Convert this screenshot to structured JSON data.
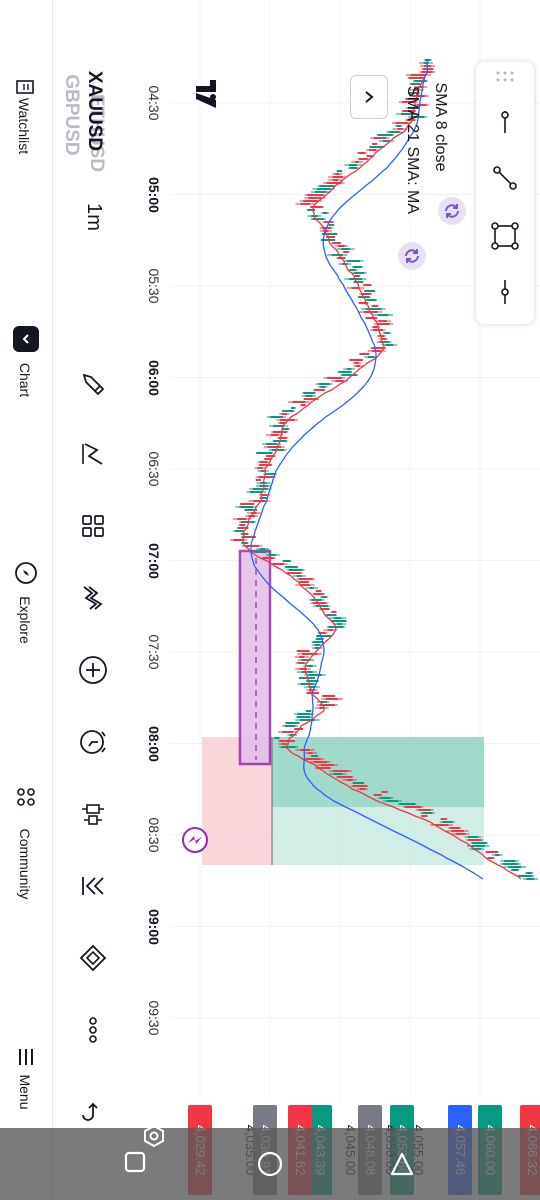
{
  "nav": {
    "watchlist_label": "Watchlist",
    "chart_label": "Chart",
    "explore_label": "Explore",
    "community_label": "Community",
    "menu_label": "Menu"
  },
  "symbols": {
    "prev_symbol": "ETHUSD",
    "current_symbol": "XAUUSD",
    "next_symbol": "GBPUSD",
    "timeframe": "1m"
  },
  "toolbar_icons": [
    "pencil-icon",
    "pattern-icon",
    "layout-grid-icon",
    "indicators-icon",
    "add-icon",
    "alert-clock-icon",
    "candle-style-icon",
    "replay-icon",
    "layers-icon",
    "more-icon",
    "undo-icon"
  ],
  "time_ticks": [
    {
      "label": "04:30",
      "bold": false
    },
    {
      "label": "05:00",
      "bold": true
    },
    {
      "label": "05:30",
      "bold": false
    },
    {
      "label": "06:00",
      "bold": true
    },
    {
      "label": "06:30",
      "bold": false
    },
    {
      "label": "07:00",
      "bold": true
    },
    {
      "label": "07:30",
      "bold": false
    },
    {
      "label": "08:00",
      "bold": true
    },
    {
      "label": "08:30",
      "bold": false
    },
    {
      "label": "09:00",
      "bold": true
    },
    {
      "label": "09:30",
      "bold": false
    }
  ],
  "indicators": {
    "sma8_label": "SMA 8 close",
    "sma21_label": "SMA 21 SMA: MA"
  },
  "price_labels": [
    {
      "text": "4,066.32",
      "color": "#f23645"
    },
    {
      "text": "4,060.00",
      "color": "#089981"
    },
    {
      "text": "4,057.46",
      "color": "#2962ff"
    },
    {
      "text": "4,055.00",
      "color": ""
    },
    {
      "text": "4,053.60",
      "color": "#089981"
    },
    {
      "text": "4,050.00",
      "color": ""
    },
    {
      "text": "4,048.08",
      "color": "#787b86"
    },
    {
      "text": "4,045.00",
      "color": ""
    },
    {
      "text": "4,043.39",
      "color": "#089981"
    },
    {
      "text": "4,041.62",
      "color": "#f23645"
    },
    {
      "text": "4,035.00",
      "color": ""
    },
    {
      "text": "4,030.91",
      "color": "#787b86"
    },
    {
      "text": "4,029.42",
      "color": "#f23645"
    }
  ],
  "colors": {
    "up": "#089981",
    "down": "#f23645",
    "sma8": "#f23645",
    "sma21": "#2962ff",
    "accent": "#9c27b0"
  }
}
